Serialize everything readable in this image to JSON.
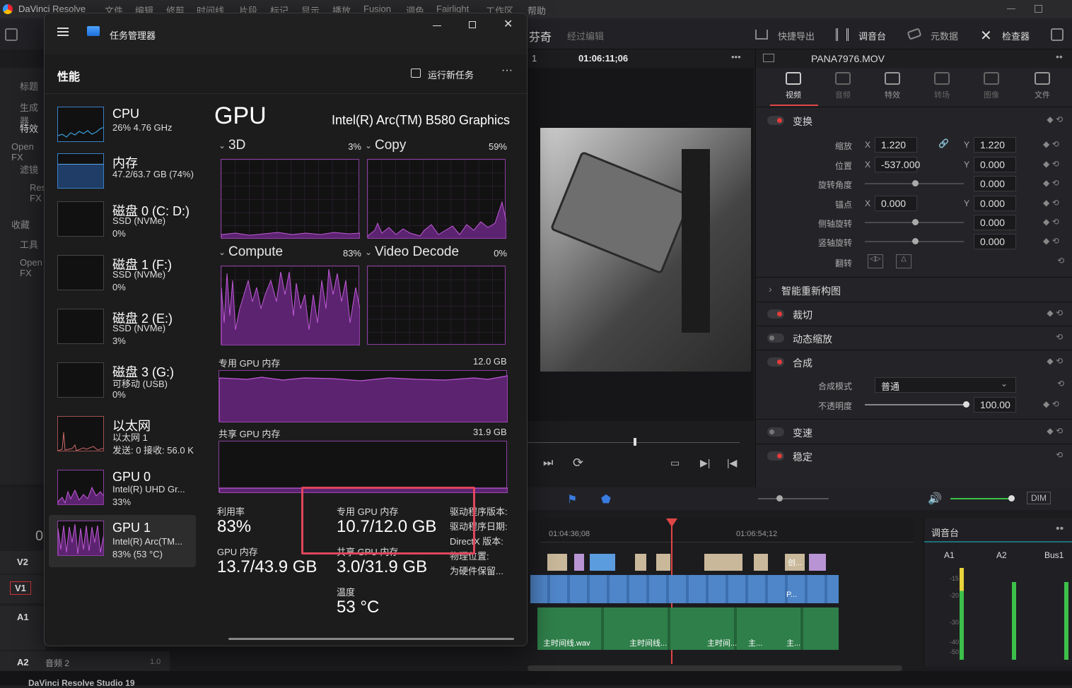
{
  "resolve": {
    "app_title": "DaVinci Resolve",
    "menu": [
      "文件",
      "编辑",
      "修剪",
      "时间线",
      "片段",
      "标记",
      "显示",
      "播放",
      "Fusion",
      "调色",
      "Fairlight",
      "工作区",
      "帮助"
    ],
    "project_name": "芬奇",
    "project_status": "经过编辑",
    "toolbar": {
      "quick_export": "快捷导出",
      "mixer": "调音台",
      "metadata": "元数据",
      "inspector": "检查器"
    },
    "timecode": "01:06:11;06",
    "viewer_zoom": "1",
    "left_panel": [
      "标题",
      "生成器",
      "特效",
      "Open FX",
      "滤镜",
      "Resolve FX",
      "收藏",
      "工具",
      "Open FX"
    ],
    "inspector": {
      "clip_name": "PANA7976.MOV",
      "tabs": [
        "视频",
        "音频",
        "特效",
        "转场",
        "图像",
        "文件"
      ],
      "transform": {
        "title": "变换",
        "zoom_label": "缩放",
        "zoom_x": "1.220",
        "zoom_y": "1.220",
        "position_label": "位置",
        "position_x": "-537.000",
        "position_y": "0.000",
        "rotation_label": "旋转角度",
        "rotation": "0.000",
        "anchor_label": "锚点",
        "anchor_x": "0.000",
        "anchor_y": "0.000",
        "pitch_label": "侧轴旋转",
        "pitch": "0.000",
        "yaw_label": "竖轴旋转",
        "yaw": "0.000",
        "flip_label": "翻转",
        "x": "X",
        "y": "Y"
      },
      "smart_reframe": "智能重新构图",
      "crop": "裁切",
      "dynamic_zoom": "动态缩放",
      "composite": {
        "title": "合成",
        "mode_label": "合成模式",
        "mode": "普通",
        "opacity_label": "不透明度",
        "opacity": "100.00"
      },
      "speed": "变速",
      "stabilize": "稳定"
    },
    "timeline": {
      "tc1": "01:04:36;08",
      "tc2": "01:06:54;12",
      "tracks": [
        "V2",
        "V1",
        "A1",
        "A2"
      ],
      "track_zero": "0",
      "a2_name": "音频 2",
      "a2_level": "1.0",
      "clips": [
        "主时间线.wav",
        "主时间线...",
        "主时间...",
        "主...",
        "主...",
        "创...",
        "P..."
      ],
      "dim": "DIM"
    },
    "mixer": {
      "title": "调音台",
      "channels": [
        "A1",
        "A2",
        "Bus1"
      ],
      "scale": [
        "-15",
        "-20",
        "-30",
        "-40",
        "-50"
      ]
    },
    "status": "DaVinci Resolve Studio 19"
  },
  "taskmgr": {
    "title": "任务管理器",
    "section": "性能",
    "run_task": "运行新任务",
    "sidebar": [
      {
        "name": "CPU",
        "line1": "26%  4.76 GHz",
        "line2": ""
      },
      {
        "name": "内存",
        "line1": "47.2/63.7 GB (74%)",
        "line2": ""
      },
      {
        "name": "磁盘 0 (C: D:)",
        "line1": "SSD (NVMe)",
        "line2": "0%"
      },
      {
        "name": "磁盘 1 (F:)",
        "line1": "SSD (NVMe)",
        "line2": "0%"
      },
      {
        "name": "磁盘 2 (E:)",
        "line1": "SSD (NVMe)",
        "line2": "3%"
      },
      {
        "name": "磁盘 3 (G:)",
        "line1": "可移动 (USB)",
        "line2": "0%"
      },
      {
        "name": "以太网",
        "line1": "以太网 1",
        "line2": "发送: 0 接收: 56.0 K"
      },
      {
        "name": "GPU 0",
        "line1": "Intel(R) UHD Gr...",
        "line2": "33%"
      },
      {
        "name": "GPU 1",
        "line1": "Intel(R) Arc(TM...",
        "line2": "83% (53 °C)"
      }
    ],
    "gpu_title": "GPU",
    "gpu_model": "Intel(R) Arc(TM) B580 Graphics",
    "engines": [
      {
        "name": "3D",
        "value": "3%"
      },
      {
        "name": "Copy",
        "value": "59%"
      },
      {
        "name": "Compute",
        "value": "83%"
      },
      {
        "name": "Video Decode",
        "value": "0%"
      }
    ],
    "dedicated_label": "专用 GPU 内存",
    "dedicated_max": "12.0 GB",
    "shared_label": "共享 GPU 内存",
    "shared_max": "31.9 GB",
    "stats": {
      "util_label": "利用率",
      "util": "83%",
      "gpumem_label": "GPU 内存",
      "gpumem": "13.7/43.9 GB",
      "ded_label": "专用 GPU 内存",
      "ded": "10.7/12.0 GB",
      "shr_label": "共享 GPU 内存",
      "shr": "3.0/31.9 GB",
      "temp_label": "温度",
      "temp": "53 °C",
      "drv_ver": "驱动程序版本:",
      "drv_date": "驱动程序日期:",
      "dx": "DirectX 版本:",
      "phys": "物理位置:",
      "reserved": "为硬件保留..."
    }
  }
}
